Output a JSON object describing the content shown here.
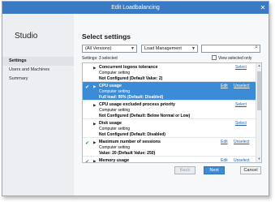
{
  "window": {
    "title": "Edit Loadbalancing",
    "close_glyph": "✕"
  },
  "sidebar": {
    "title": "Studio",
    "items": [
      {
        "label": "Settings",
        "active": true
      },
      {
        "label": "Users and Machines",
        "active": false
      },
      {
        "label": "Summary",
        "active": false
      }
    ]
  },
  "main": {
    "heading": "Select settings",
    "version_filter": {
      "value": "(All Versions)"
    },
    "category_filter": {
      "value": "Load Management"
    },
    "search": {
      "value": "",
      "icon": "search-icon"
    },
    "selected_count": "Settings: 3 selected",
    "view_selected_only": {
      "label": "View selected only",
      "checked": false
    }
  },
  "settings": [
    {
      "name": "Concurrent logons tolerance",
      "type": "Computer setting",
      "value": "Not Configured (Default Value: 2)",
      "selected": false,
      "checked": false,
      "actions": [
        "Select"
      ]
    },
    {
      "name": "CPU usage",
      "type": "Computer setting",
      "value": "Full load: 95% (Default: Disabled)",
      "selected": true,
      "checked": true,
      "actions": [
        "Edit",
        "Unselect"
      ]
    },
    {
      "name": "CPU usage excluded process priority",
      "type": "Computer setting",
      "value": "Not Configured (Default: Below Normal or Low)",
      "selected": false,
      "checked": false,
      "actions": [
        "Select"
      ]
    },
    {
      "name": "Disk usage",
      "type": "Computer setting",
      "value": "Not Configured (Default: Disabled)",
      "selected": false,
      "checked": false,
      "actions": [
        "Select"
      ]
    },
    {
      "name": "Maximum number of sessions",
      "type": "Computer setting",
      "value": "Value: 20 (Default Value: 250)",
      "selected": false,
      "checked": true,
      "actions": [
        "Edit",
        "Unselect"
      ]
    },
    {
      "name": "Memory usage",
      "type": "Computer setting",
      "value": "",
      "selected": false,
      "checked": true,
      "actions": [
        "Edit",
        "Unselect"
      ]
    }
  ],
  "buttons": {
    "back": "Back",
    "next": "Next",
    "cancel": "Cancel"
  },
  "icons": {
    "check": "✔",
    "expand": "▶",
    "dropdown": "▼",
    "scroll_up": "▲",
    "scroll_down": "▼"
  },
  "colors": {
    "titlebar": "#3a79c4",
    "selected_row": "#3b8bd6",
    "check": "#2a9a3c",
    "link": "#1f5fa8"
  }
}
